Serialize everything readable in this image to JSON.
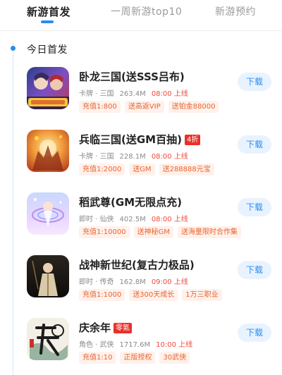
{
  "tabs": [
    {
      "label": "新游首发"
    },
    {
      "label": "一周新游top10"
    },
    {
      "label": "新游预约"
    }
  ],
  "section": {
    "title": "今日首发"
  },
  "games": [
    {
      "name": "卧龙三国(送SSS吕布)",
      "badge": "",
      "genre": "卡牌 · 三国",
      "size": "263.4M",
      "time": "08:00 上线",
      "tags": [
        "充值1:800",
        "送高返VIP",
        "送铂金88000"
      ]
    },
    {
      "name": "兵临三国(送GM百抽)",
      "badge": "4折",
      "genre": "卡牌 · 三国",
      "size": "228.1M",
      "time": "08:00 上线",
      "tags": [
        "充值1:2000",
        "送GM",
        "送288888元宝"
      ]
    },
    {
      "name": "稻武尊(GM无限点充)",
      "badge": "",
      "genre": "即时 · 仙侠",
      "size": "402.5M",
      "time": "08:00 上线",
      "tags": [
        "充值1:10000",
        "送神秘GM",
        "送海量限时合作集"
      ]
    },
    {
      "name": "战神新世纪(复古力极品)",
      "badge": "",
      "genre": "即时 · 传奇",
      "size": "162.8M",
      "time": "09:00 上线",
      "tags": [
        "充值1:1000",
        "送300天成长",
        "1万三职业"
      ]
    },
    {
      "name": "庆余年",
      "badge": "零氪",
      "genre": "角色 · 武侠",
      "size": "1717.6M",
      "time": "10:00 上线",
      "tags": [
        "充值1:10",
        "正版授权",
        "30武侠"
      ]
    }
  ],
  "download_label": "下载",
  "colors": {
    "accent": "#2a8cf0",
    "time": "#f04a3a",
    "tag_text": "#e8642f",
    "tag_bg": "#fff1eb",
    "badge": "#e8312a"
  }
}
